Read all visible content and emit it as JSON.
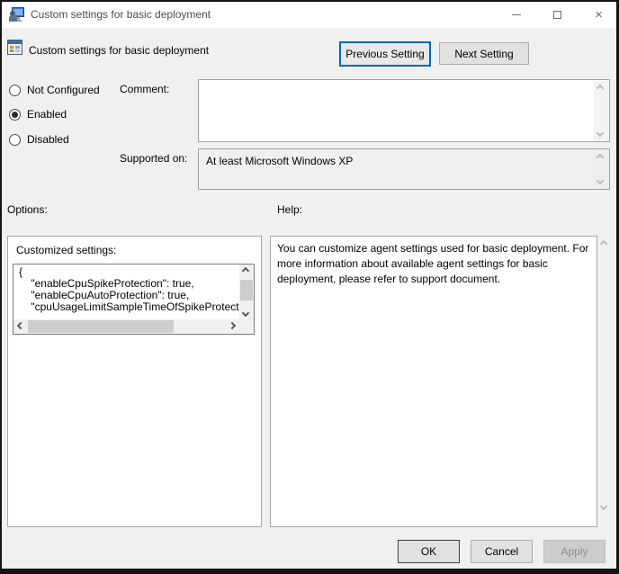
{
  "window": {
    "title": "Custom settings for basic deployment"
  },
  "header": {
    "title": "Custom settings for basic deployment",
    "previous_label": "Previous Setting",
    "next_label": "Next Setting"
  },
  "config": {
    "radios": [
      {
        "label": "Not Configured",
        "selected": false
      },
      {
        "label": "Enabled",
        "selected": true
      },
      {
        "label": "Disabled",
        "selected": false
      }
    ]
  },
  "comment": {
    "label": "Comment:",
    "value": ""
  },
  "supported": {
    "label": "Supported on:",
    "value": "At least Microsoft Windows XP"
  },
  "options": {
    "section_label": "Options:",
    "group_label": "Customized settings:",
    "code_lines": [
      "{",
      "    \"enableCpuSpikeProtection\": true,",
      "    \"enableCpuAutoProtection\": true,",
      "    \"cpuUsageLimitSampleTimeOfSpikeProtect"
    ]
  },
  "help": {
    "section_label": "Help:",
    "body": "You can customize agent settings used for basic deployment. For more information about available agent settings for basic deployment, please refer to support document."
  },
  "footer": {
    "ok_label": "OK",
    "cancel_label": "Cancel",
    "apply_label": "Apply"
  },
  "icons": {
    "close_glyph": "×"
  },
  "colors": {
    "focus_blue": "#0066b4",
    "dialog_bg": "#f0f0f0",
    "titlebar_bg": "#ffffff",
    "panel_bg": "#ffffff"
  }
}
